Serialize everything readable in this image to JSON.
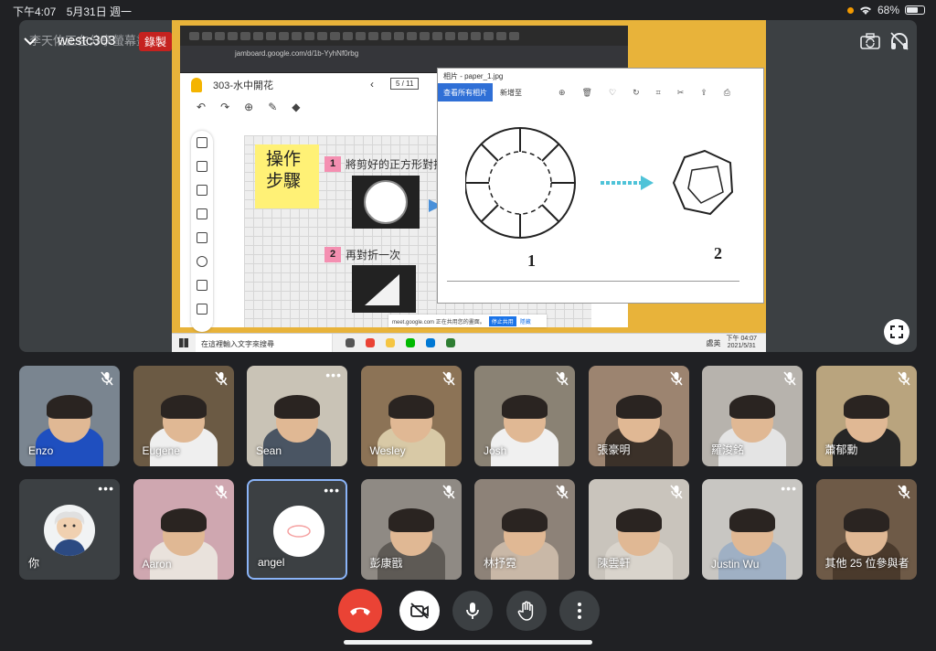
{
  "status_bar": {
    "time": "下午4:07",
    "date": "5月31日 週一",
    "battery": "68%",
    "battery_level": 0.68
  },
  "meeting": {
    "presenting_text": "李天佑正在分享螢幕畫面",
    "name": "westc303",
    "recording_label": "錄製"
  },
  "shared_screen": {
    "tab_url": "jamboard.google.com/d/1b-YyhNf0rbg",
    "jamboard_title": "303-水中開花",
    "frame_indicator": "5 / 11",
    "sticky_note": "操作步驟",
    "step1_number": "1",
    "step1_text": "將剪好的正方形對折",
    "step2_number": "2",
    "step2_text": "再對折一次",
    "viewer_title": "相片 - paper_1.jpg",
    "viewer_all_photos": "查看所有相片",
    "viewer_new": "新增至",
    "figure1_label": "1",
    "figure2_label": "2",
    "share_notice": "meet.google.com 正在共用您的畫面。",
    "share_stop": "停止共用",
    "share_hide": "隱藏",
    "taskbar_search": "在這裡輸入文字來搜尋",
    "taskbar_lang": "處英",
    "taskbar_time": "下午 04:07",
    "taskbar_date": "2021/5/31"
  },
  "participants": [
    {
      "name": "Enzo",
      "muted": true,
      "bg": "#7a8590",
      "shirt": "#1f4fbf"
    },
    {
      "name": "Eugene",
      "muted": true,
      "bg": "#6b5a44",
      "shirt": "#efefef"
    },
    {
      "name": "Sean",
      "muted": false,
      "bg": "#c9c3b6",
      "shirt": "#4a5563"
    },
    {
      "name": "Wesley",
      "muted": true,
      "bg": "#8c7356",
      "shirt": "#d8c9a6"
    },
    {
      "name": "Josh",
      "muted": true,
      "bg": "#8a8274",
      "shirt": "#f0f0f0"
    },
    {
      "name": "張豪明",
      "muted": true,
      "bg": "#9c8470",
      "shirt": "#3b3129"
    },
    {
      "name": "羅浚銘",
      "muted": true,
      "bg": "#b7b3ad",
      "shirt": "#e4e4e4"
    },
    {
      "name": "蕭郁勳",
      "muted": true,
      "bg": "#b9a47e",
      "shirt": "#262626"
    },
    {
      "name": "你",
      "muted": false,
      "bg": "#3c4043",
      "shirt": ""
    },
    {
      "name": "Aaron",
      "muted": true,
      "bg": "#cfa7b0",
      "shirt": "#e9e2dc"
    },
    {
      "name": "angel",
      "muted": false,
      "bg": "#3c4043",
      "shirt": ""
    },
    {
      "name": "彭康戩",
      "muted": true,
      "bg": "#8f8a84",
      "shirt": "#5e5a55"
    },
    {
      "name": "林抒霓",
      "muted": true,
      "bg": "#8d8278",
      "shirt": "#c9b8a7"
    },
    {
      "name": "陳雲軒",
      "muted": true,
      "bg": "#c9c4bc",
      "shirt": "#d9d4cc"
    },
    {
      "name": "Justin Wu",
      "muted": false,
      "bg": "#c8c6c2",
      "shirt": "#9fb0c4"
    },
    {
      "name": "其他 25 位參與者",
      "muted": true,
      "bg": "#6e5a47",
      "shirt": "#4a3a2c"
    }
  ],
  "icons": {
    "end_call": "end-call-icon",
    "camera_off": "camera-off-icon",
    "mic": "microphone-icon",
    "raise_hand": "raise-hand-icon",
    "more": "more-vertical-icon"
  },
  "colors": {
    "end_call": "#ea4335",
    "recording": "#c5221f",
    "active_speaker_border": "#8ab4f8"
  }
}
